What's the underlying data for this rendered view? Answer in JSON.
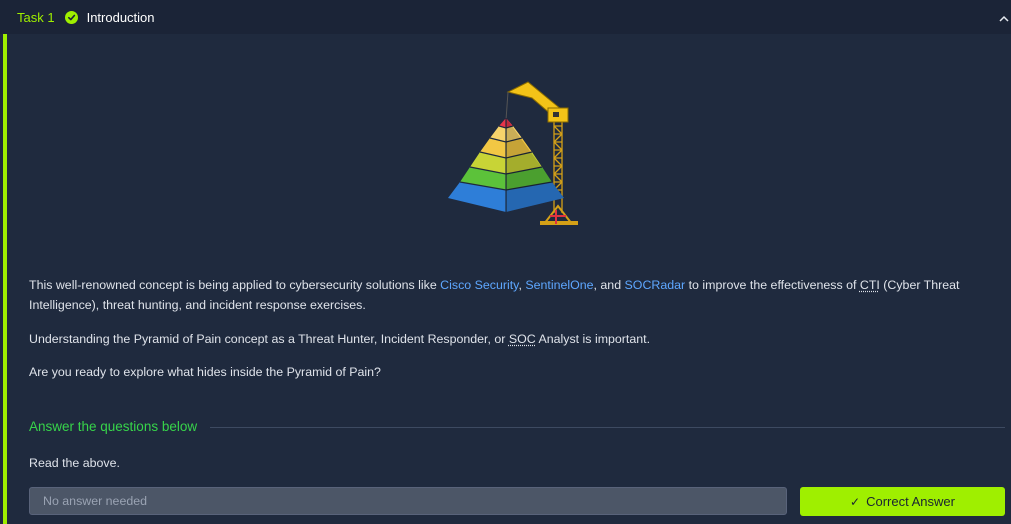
{
  "task": {
    "number_label": "Task 1",
    "title": "Introduction",
    "status": "completed"
  },
  "content": {
    "intro_before": "This well-renowned concept is being applied to cybersecurity solutions like ",
    "links": [
      "Cisco Security",
      "SentinelOne",
      "SOCRadar"
    ],
    "sep1": ", ",
    "sep2": ", and ",
    "intro_after_links": " to improve the effectiveness of ",
    "abbr_cti": "CTI",
    "intro_end": " (Cyber Threat Intelligence), threat hunting, and incident response exercises.",
    "p2_before": "Understanding the Pyramid of Pain concept as a Threat Hunter, Incident Responder, or ",
    "abbr_soc": "SOC",
    "p2_after": " Analyst is important.",
    "p3": "Are you ready to explore what hides inside the Pyramid of Pain?"
  },
  "questions": {
    "section_title": "Answer the questions below",
    "items": [
      {
        "text": "Read the above.",
        "placeholder": "No answer needed",
        "button_label": "Correct Answer"
      }
    ]
  },
  "colors": {
    "accent": "#9fef00",
    "link": "#5ea7ff",
    "section_title": "#37d44a"
  },
  "icons": {
    "status": "check-circle-icon",
    "collapse": "chevron-up-icon",
    "button": "checkmark-icon"
  }
}
